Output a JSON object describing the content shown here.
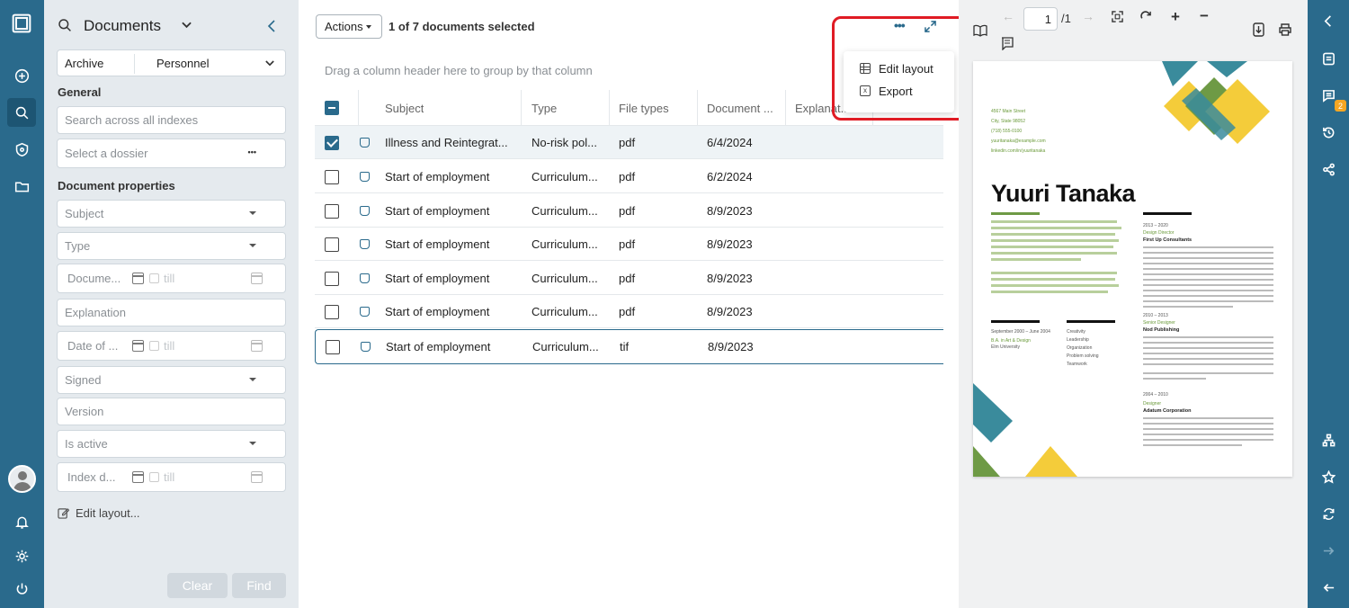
{
  "panel": {
    "title": "Documents",
    "archive_label": "Archive",
    "archive_value": "Personnel",
    "general_label": "General",
    "search_placeholder": "Search across all indexes",
    "dossier_placeholder": "Select a dossier",
    "dossier_more": "•••",
    "doc_props_label": "Document properties",
    "fields": {
      "subject": "Subject",
      "type": "Type",
      "document_date": "Docume...",
      "explanation": "Explanation",
      "date_of": "Date of ...",
      "signed": "Signed",
      "version": "Version",
      "is_active": "Is active",
      "index_date": "Index d...",
      "till": "till"
    },
    "edit_layout": "Edit layout...",
    "clear_label": "Clear",
    "find_label": "Find"
  },
  "main": {
    "actions_label": "Actions",
    "selection_text": "1 of 7 documents selected",
    "group_hint": "Drag a column header here to group by that column",
    "columns": [
      "Subject",
      "Type",
      "File types",
      "Document ...",
      "Explanat..."
    ],
    "rows": [
      {
        "subject": "Illness and Reintegrat...",
        "type": "No-risk pol...",
        "file_type": "pdf",
        "date": "6/4/2024",
        "checked": true
      },
      {
        "subject": "Start of employment",
        "type": "Curriculum...",
        "file_type": "pdf",
        "date": "6/2/2024",
        "checked": false
      },
      {
        "subject": "Start of employment",
        "type": "Curriculum...",
        "file_type": "pdf",
        "date": "8/9/2023",
        "checked": false
      },
      {
        "subject": "Start of employment",
        "type": "Curriculum...",
        "file_type": "pdf",
        "date": "8/9/2023",
        "checked": false
      },
      {
        "subject": "Start of employment",
        "type": "Curriculum...",
        "file_type": "pdf",
        "date": "8/9/2023",
        "checked": false
      },
      {
        "subject": "Start of employment",
        "type": "Curriculum...",
        "file_type": "pdf",
        "date": "8/9/2023",
        "checked": false
      },
      {
        "subject": "Start of employment",
        "type": "Curriculum...",
        "file_type": "tif",
        "date": "8/9/2023",
        "checked": false
      }
    ],
    "menu": {
      "edit_layout": "Edit layout",
      "export": "Export"
    }
  },
  "viewer": {
    "page_current": "1",
    "page_total": "/1",
    "cv": {
      "name": "Yuuri Tanaka",
      "contact": [
        "4567 Main Street",
        "City, State 98052",
        "(718) 555-0100",
        "yuuritanaka@example.com",
        "linkedin.com/in/yuuritanaka"
      ],
      "job1_years": "2013 – 2020",
      "job1_title": "Design Director",
      "job1_company": "First Up Consultants",
      "job2_years": "2010 – 2013",
      "job2_title": "Senior Designer",
      "job2_company": "Nod Publishing",
      "job3_years": "2004 – 2010",
      "job3_title": "Designer",
      "job3_company": "Adatum Corporation",
      "edu_years": "September 2000 – June 2004",
      "edu_degree": "B.A. in Art & Design",
      "edu_school": "Elm University",
      "skills": [
        "Creativity",
        "Leadership",
        "Organization",
        "Problem solving",
        "Teamwork"
      ]
    }
  },
  "right_rail": {
    "badge": "2"
  },
  "colors": {
    "rail": "#2a6a8c",
    "panel": "#e5eaee",
    "highlight": "#e01b24"
  }
}
